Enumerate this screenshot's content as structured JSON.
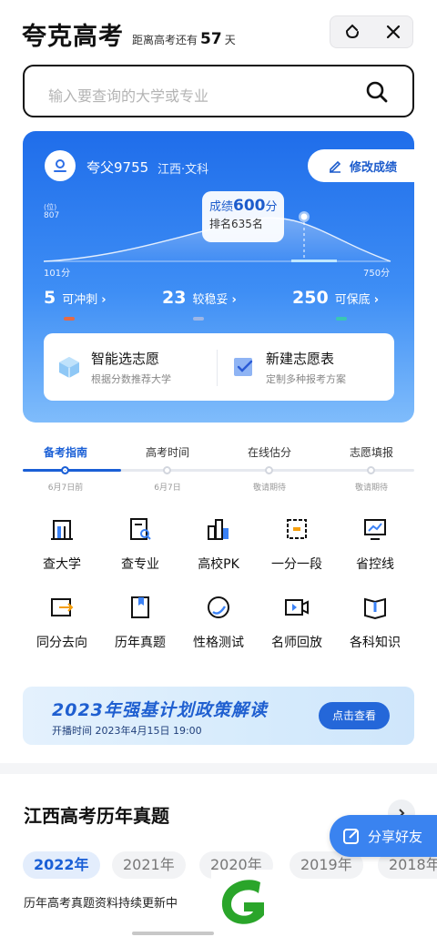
{
  "header": {
    "app_title": "夸克高考",
    "countdown_prefix": "距离高考还有",
    "countdown_days": "57",
    "countdown_suffix": "天"
  },
  "search": {
    "placeholder": "输入要查询的大学或专业"
  },
  "profile": {
    "user_name": "夸父9755",
    "region": "江西·文科",
    "edit_label": "修改成绩"
  },
  "chart_data": {
    "type": "area",
    "y_unit": "(位)",
    "y_max_label": "807",
    "x_min_label": "101分",
    "x_max_label": "750分",
    "score_label_prefix": "成绩",
    "score": "600",
    "score_unit": "分",
    "rank_label": "排名635名"
  },
  "counts": [
    {
      "value": "5",
      "label": "可冲刺",
      "color": "#e56a45"
    },
    {
      "value": "23",
      "label": "较稳妥",
      "color": "#9db6e6"
    },
    {
      "value": "250",
      "label": "可保底",
      "color": "#39c7b3"
    }
  ],
  "features": [
    {
      "title": "智能选志愿",
      "sub": "根据分数推荐大学"
    },
    {
      "title": "新建志愿表",
      "sub": "定制多种报考方案"
    }
  ],
  "timeline": [
    {
      "label": "备考指南",
      "date": "6月7日前",
      "active": true
    },
    {
      "label": "高考时间",
      "date": "6月7日",
      "active": false
    },
    {
      "label": "在线估分",
      "date": "敬请期待",
      "active": false
    },
    {
      "label": "志愿填报",
      "date": "敬请期待",
      "active": false
    }
  ],
  "grid": [
    {
      "label": "查大学",
      "icon": "university-icon"
    },
    {
      "label": "查专业",
      "icon": "major-search-icon"
    },
    {
      "label": "高校PK",
      "icon": "college-pk-icon"
    },
    {
      "label": "一分一段",
      "icon": "score-segment-icon"
    },
    {
      "label": "省控线",
      "icon": "control-line-icon"
    },
    {
      "label": "同分去向",
      "icon": "same-score-icon"
    },
    {
      "label": "历年真题",
      "icon": "past-papers-icon"
    },
    {
      "label": "性格测试",
      "icon": "personality-test-icon"
    },
    {
      "label": "名师回放",
      "icon": "teacher-replay-icon"
    },
    {
      "label": "各科知识",
      "icon": "subject-knowledge-icon"
    }
  ],
  "banner": {
    "title": "2023年强基计划政策解读",
    "sub": "开播时间 2023年4月15日 19:00",
    "button": "点击查看"
  },
  "papers": {
    "title": "江西高考历年真题",
    "years": [
      "2022年",
      "2021年",
      "2020年",
      "2019年",
      "2018年"
    ],
    "note": "历年高考真题资料持续更新中"
  },
  "share": {
    "label": "分享好友"
  },
  "colors": {
    "accent": "#1a5fd6",
    "card_top": "#1f6dea",
    "logo_green": "#2aa52a"
  }
}
